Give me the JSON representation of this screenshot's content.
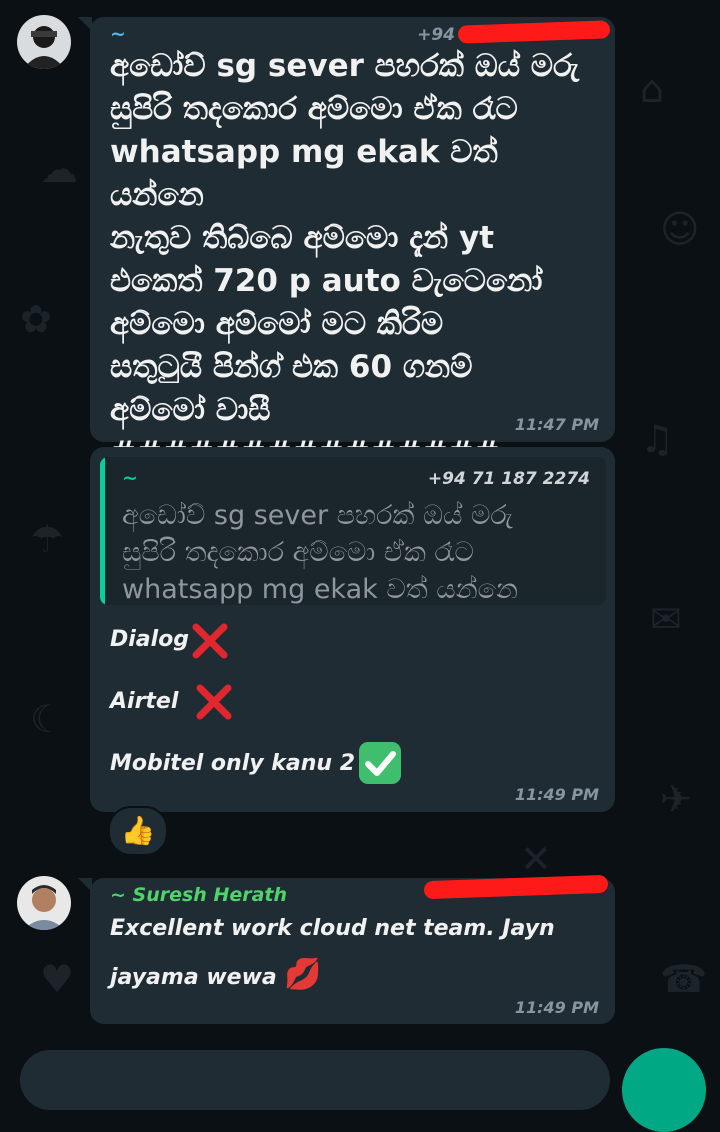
{
  "messages": [
    {
      "sender": "~",
      "phone": "+94",
      "text": "අඩෝව් sg sever පහරක් ඔය් මරු\nසුපිරි තදකොර අම්මො ඒක රෑට\nwhatsapp mg ekak වත් යන්නෙ\nනැතුව තිබ්බෙ අම්මො දැන් yt\nඑකෙත් 720 p auto වැටෙනෝ\nඅම්මො අම්මෝ මට කිරිම\nසතුටුයී පින්ග් එක 60 ගනම්\nඅම්මෝ වාසී ###############\nහූටඌටඌටඌටඌටඌ",
      "time": "11:47 PM"
    },
    {
      "quoted": {
        "sender": "~",
        "phone": "+94 71 187 2274",
        "text": "අඩෝව් sg sever පහරක් ඔය් මරු\nසුපිරි තදකොර අම්මො ඒක රෑට\nwhatsapp mg ekak වත් යන්නෙ නැතු..."
      },
      "lines": [
        {
          "text": "Dialog",
          "mark": "cross-mark-icon"
        },
        {
          "text": "Airtel",
          "mark": "cross-mark-icon"
        },
        {
          "text": "Mobitel  only kanu 2",
          "mark": "check-mark-icon"
        }
      ],
      "time": "11:49 PM",
      "reaction": "👍"
    },
    {
      "sender": "~ Suresh Herath",
      "phone": "",
      "text_line1": "Excellent work cloud net team. Jayn",
      "text_line2": "jayama wewa",
      "emoji": "💋",
      "time": "11:49 PM"
    }
  ],
  "colors": {
    "bubble": "#1f2c34",
    "background": "#0b1014",
    "accent_green": "#06cf9c",
    "redaction": "#ff1a1a",
    "cross": "#e0262f",
    "check": "#3fbf6e"
  }
}
